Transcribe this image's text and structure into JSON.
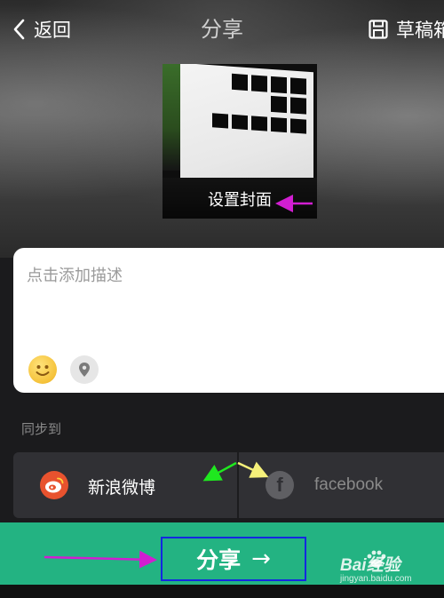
{
  "header": {
    "back_label": "返回",
    "title": "分享",
    "drafts_label": "草稿箱"
  },
  "cover": {
    "label": "设置封面"
  },
  "description": {
    "placeholder": "点击添加描述",
    "emoji_icon": "emoji-icon",
    "location_icon": "location-pin-icon"
  },
  "sync": {
    "label": "同步到",
    "targets": [
      {
        "name": "新浪微博",
        "icon": "weibo-icon",
        "active": true
      },
      {
        "name": "facebook",
        "icon": "facebook-icon",
        "active": false
      }
    ]
  },
  "footer": {
    "share_label": "分享",
    "share_arrow": "→"
  },
  "watermark": {
    "brand": "Bai经验",
    "url": "jingyan.baidu.com"
  },
  "colors": {
    "accent_green": "#23b382",
    "weibo_red": "#e8522e",
    "annotation_magenta": "#d11ed1",
    "annotation_green": "#1fe81f",
    "annotation_yellow": "#f5f07a",
    "highlight_blue": "#1428e0"
  }
}
